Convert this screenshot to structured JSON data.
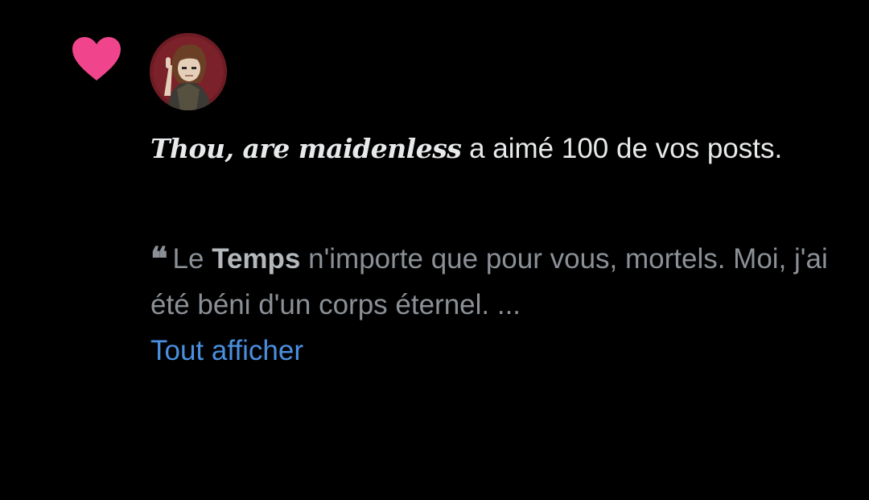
{
  "notification": {
    "type_icon": "heart-icon",
    "heart_color": "#f0458c",
    "avatar_label": "user-avatar",
    "username": "Thou, are maidenless",
    "action_text": " a aimé 100 de vos posts.",
    "quote": {
      "icon": "quote-icon",
      "glyph": "❝",
      "prefix": "Le ",
      "emphasis": "Temps",
      "suffix": " n'importe que pour vous, mortels. Moi, j'ai été béni d'un corps éternel. ..."
    },
    "show_all_label": "Tout afficher",
    "link_color": "#4a8fe0"
  }
}
